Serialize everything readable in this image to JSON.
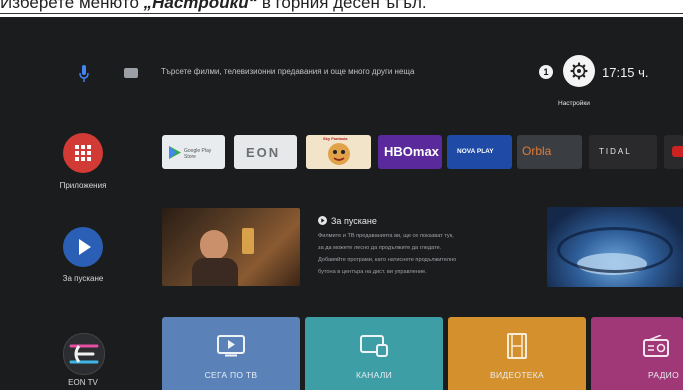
{
  "caption": {
    "prefix": "Изберете менюто ",
    "emphasis": "„Настройки“",
    "suffix": " в горния десен ъгъл."
  },
  "top_bar": {
    "search_placeholder": "Търсете филми, телевизионни предавания и още много други неща",
    "notification_badge": "1",
    "settings_label": "Настройки",
    "clock": "17:15 ч.",
    "icons": {
      "mic": "mic-icon",
      "keyboard": "keyboard-icon",
      "settings": "gear-icon"
    }
  },
  "sidebar": {
    "apps_label": "Приложения",
    "play_label": "За пускане",
    "fon_label": "EON TV",
    "colors": {
      "apps": "#d23a35",
      "play": "#2a5fb5"
    }
  },
  "apps_row": [
    {
      "label": "Google Play Store",
      "bg": "#e9ecef"
    },
    {
      "label": "EON",
      "bg": "#e6e8ea"
    },
    {
      "label": "Sky Fantasia",
      "bg": "#f2e4c8"
    },
    {
      "label": "HBOmax",
      "bg": "#5a2a9c"
    },
    {
      "label": "NOVA PLAY",
      "bg": "#1f4aa6"
    },
    {
      "label": "Orbla",
      "bg": "#3a3d41"
    },
    {
      "label": "TIDAL",
      "bg": "#2a2a2c"
    },
    {
      "label": "",
      "bg": "#cc2222"
    }
  ],
  "play_next": {
    "title": "За пускане",
    "lines": [
      "Филмите и ТВ предаванията ви, ще се показват тук,",
      "за да можете лесно да продължите да гледате.",
      "Добавяйте програми, като натиснете продължително",
      "бутона в центъра на дист. ви управление."
    ]
  },
  "categories": [
    {
      "label": "СЕГА ПО ТВ",
      "color": "#5a82b8",
      "icon": "tv-icon"
    },
    {
      "label": "КАНАЛИ",
      "color": "#3e9ea5",
      "icon": "channels-icon"
    },
    {
      "label": "ВИДЕОТЕКА",
      "color": "#d4902c",
      "icon": "film-icon"
    },
    {
      "label": "РАДИО",
      "color": "#a03878",
      "icon": "radio-icon"
    }
  ]
}
